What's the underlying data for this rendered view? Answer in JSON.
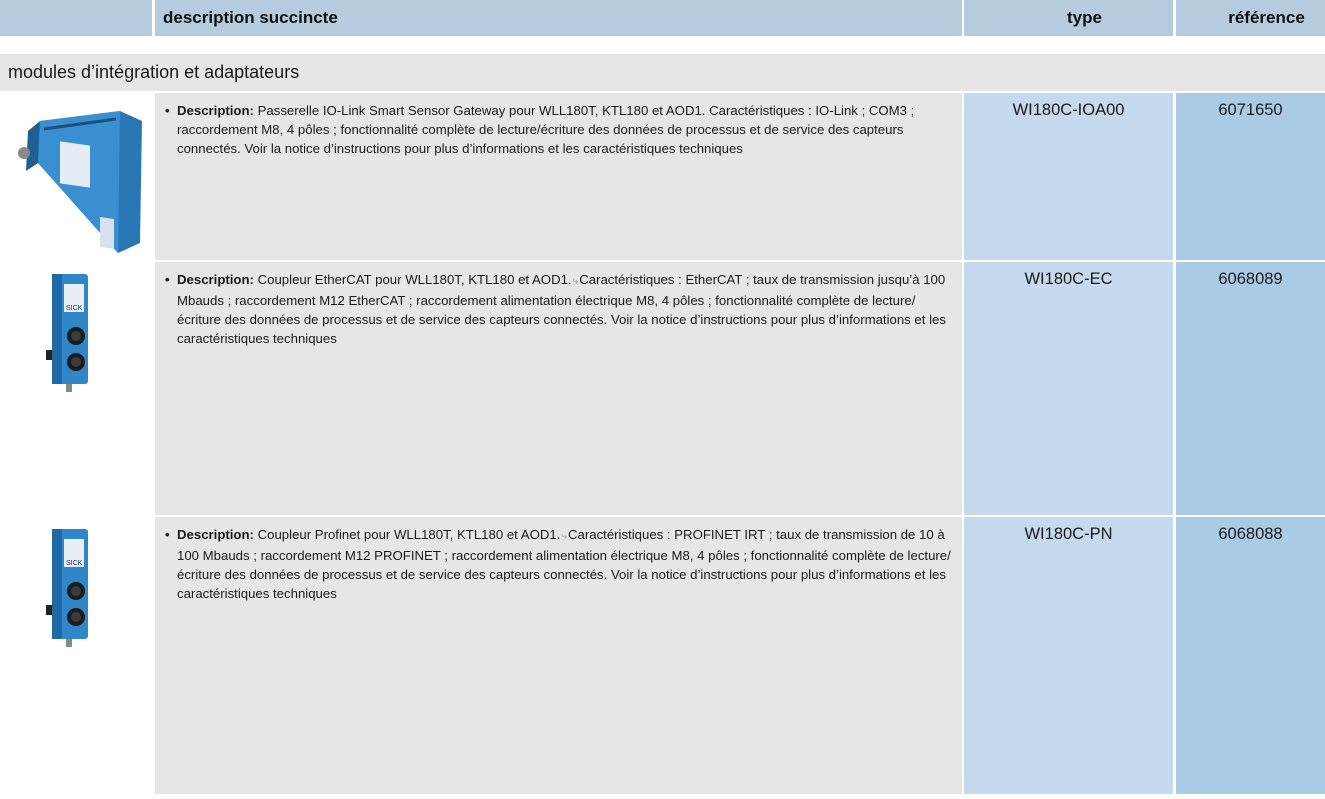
{
  "header": {
    "col_description": "description succincte",
    "col_type": "type",
    "col_reference": "référence"
  },
  "group_title": "modules d’intégration et adaptateurs",
  "rows": [
    {
      "label": "Description:",
      "text_a": "Passerelle IO-Link Smart Sensor Gateway pour WLL180T, KTL180 et AOD1. Caractéristiques : IO-Link ; COM3 ; raccordement M8, 4 pôles ; fonctionnalité complète de lecture/écriture des données de processus et de service des capteurs connectés. Voir la notice d’instructions pour plus d’informations et les caractéristiques techniques",
      "text_b": "",
      "type": "WI180C-IOA00",
      "reference": "6071650",
      "image_icon": "gateway-module-icon"
    },
    {
      "label": "Description:",
      "text_a": "Coupleur EtherCAT pour WLL180T, KTL180 et AOD1.",
      "text_b": "Caractéristiques : EtherCAT ; taux de transmission jusqu’à 100 Mbauds ; raccordement M12 EtherCAT ; raccordement alimentation électrique M8, 4 pôles ; fonctionnalité complète de lecture/écriture des données de processus et de service des capteurs connectés. Voir la notice d’instructions pour plus d’informations et les caractéristiques techniques",
      "type": "WI180C-EC",
      "reference": "6068089",
      "image_icon": "coupler-module-icon"
    },
    {
      "label": "Description:",
      "text_a": "Coupleur Profinet pour WLL180T, KTL180 et AOD1.",
      "text_b": "Caractéristiques : PROFINET IRT ; taux de transmission de 10 à 100 Mbauds ; raccordement M12 PROFINET ; raccordement alimentation électrique M8, 4 pôles ; fonctionnalité complète de lecture/écriture des données de processus et de service des capteurs connectés. Voir la notice d’instructions pour plus d’informations et les caractéristiques techniques",
      "type": "WI180C-PN",
      "reference": "6068088",
      "image_icon": "coupler-module-icon"
    }
  ],
  "colors": {
    "header_bg": "#b5ccdf",
    "desc_bg": "#e6e6e6",
    "type_bg": "#c6d9ee",
    "ref_bg": "#a9cbe5",
    "device_blue": "#2f86c8"
  }
}
